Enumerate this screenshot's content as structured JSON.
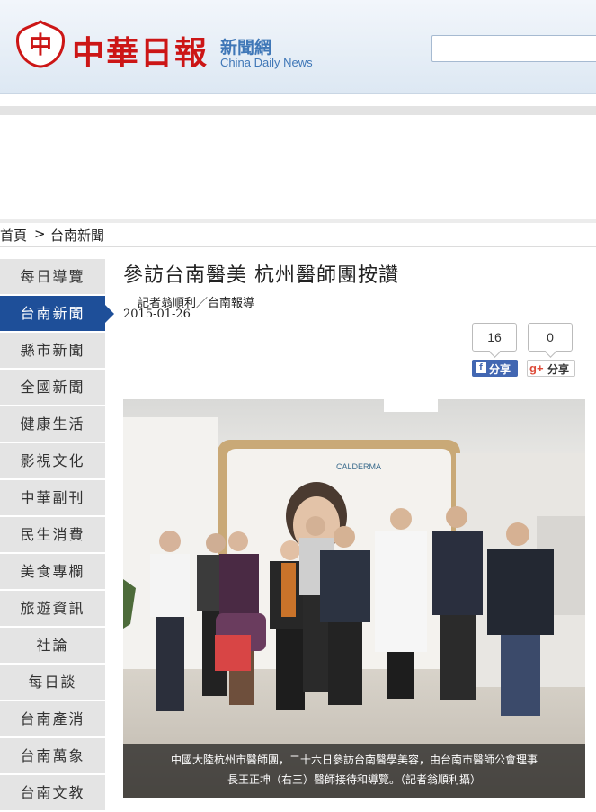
{
  "header": {
    "logo_text": "中華日報",
    "logo_badge": "中",
    "site_name": "新聞網",
    "site_name_en": "China Daily News",
    "search": {
      "value": ""
    }
  },
  "breadcrumb": {
    "home": "首頁",
    "separator": ">",
    "current": "台南新聞"
  },
  "sidebar": {
    "items": [
      {
        "label": "每日導覽",
        "active": false
      },
      {
        "label": "台南新聞",
        "active": true
      },
      {
        "label": "縣市新聞",
        "active": false
      },
      {
        "label": "全國新聞",
        "active": false
      },
      {
        "label": "健康生活",
        "active": false
      },
      {
        "label": "影視文化",
        "active": false
      },
      {
        "label": "中華副刊",
        "active": false
      },
      {
        "label": "民生消費",
        "active": false
      },
      {
        "label": "美食專欄",
        "active": false
      },
      {
        "label": "旅遊資訊",
        "active": false
      },
      {
        "label": "社論",
        "active": false
      },
      {
        "label": "每日談",
        "active": false
      },
      {
        "label": "台南產消",
        "active": false
      },
      {
        "label": "台南萬象",
        "active": false
      },
      {
        "label": "台南文教",
        "active": false
      }
    ]
  },
  "article": {
    "title": "參訪台南醫美 杭州醫師團按讚",
    "byline": "記者翁順利／台南報導",
    "date": "2015-01-26",
    "photo_sign": "CALDERMA",
    "caption_line1": "中國大陸杭州市醫師團，二十六日參訪台南醫學美容，由台南市醫師公會理事",
    "caption_line2": "長王正坤（右三）醫師接待和導覽。（記者翁順利攝）"
  },
  "share": {
    "fb_count": "16",
    "fb_label": "分享",
    "fb_icon": "f",
    "gplus_count": "0",
    "gplus_label": "分享",
    "gplus_icon": "g+"
  },
  "colors": {
    "brand_red": "#cc1616",
    "site_blue": "#3f77b7",
    "nav_active": "#1e4f99",
    "nav_inactive": "#e4e4e4",
    "facebook": "#4267b2",
    "gplus": "#dd4b39"
  }
}
